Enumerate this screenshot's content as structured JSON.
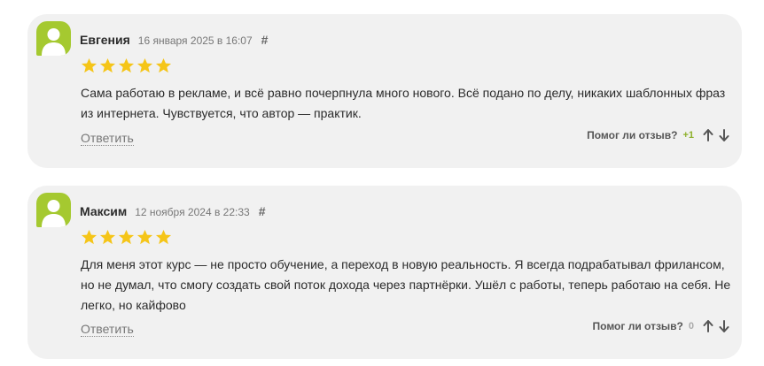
{
  "reviews": [
    {
      "author": "Евгения",
      "date": "16 января 2025 в 16:07",
      "hash": "#",
      "rating": 5,
      "text": "Сама работаю в рекламе, и всё равно почерпнула много нового. Всё подано по делу, никаких шаблонных фраз из интернета. Чувствуется, что автор — практик.",
      "reply_label": "Ответить",
      "helpful_label": "Помог ли отзыв?",
      "helpful_count": "+1"
    },
    {
      "author": "Максим",
      "date": "12 ноября 2024 в 22:33",
      "hash": "#",
      "rating": 5,
      "text": "Для меня этот курс — не просто обучение, а переход в новую реальность. Я всегда подрабатывал фрилансом, но не думал, что смогу создать свой поток дохода через партнёрки. Ушёл с работы, теперь работаю на себя. Не легко, но кайфово",
      "reply_label": "Ответить",
      "helpful_label": "Помог ли отзыв?",
      "helpful_count": "0"
    }
  ],
  "colors": {
    "avatar": "#a5c930",
    "star": "#f5c518",
    "card_bg": "#f1f1f1",
    "positive": "#8db02a"
  },
  "icons": {
    "avatar": "user-avatar-icon",
    "star": "star-icon",
    "upvote": "arrow-up-icon",
    "downvote": "arrow-down-icon"
  }
}
